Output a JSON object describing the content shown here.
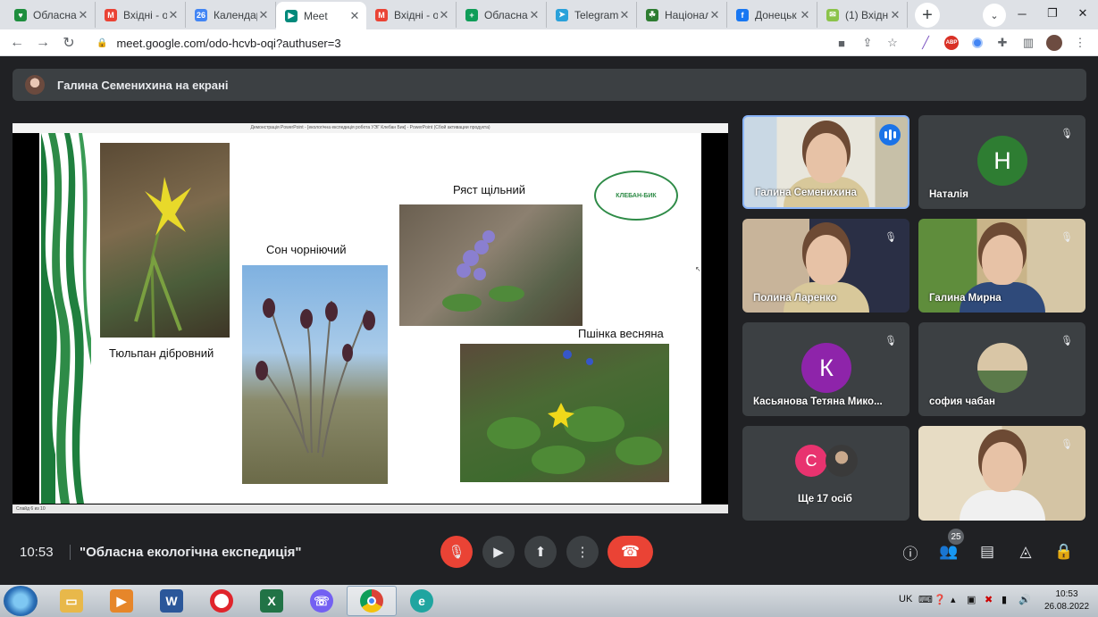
{
  "tabs": [
    {
      "title": "Обласна",
      "fav_color": "#1e8e3e",
      "fav": "♥"
    },
    {
      "title": "Вхідні - о",
      "fav_color": "#ea4335",
      "fav": "M"
    },
    {
      "title": "Календар",
      "fav_color": "#4285f4",
      "fav": "26"
    },
    {
      "title": "Meet",
      "fav_color": "#00897b",
      "fav": "▶"
    },
    {
      "title": "Вхідні - о",
      "fav_color": "#ea4335",
      "fav": "M"
    },
    {
      "title": "Обласна",
      "fav_color": "#0f9d58",
      "fav": "+"
    },
    {
      "title": "Telegram",
      "fav_color": "#2aa1da",
      "fav": "➤"
    },
    {
      "title": "Національ",
      "fav_color": "#2e7d32",
      "fav": "☘"
    },
    {
      "title": "Донецьк",
      "fav_color": "#1877f2",
      "fav": "f"
    },
    {
      "title": "(1) Вхідн",
      "fav_color": "#8bc34a",
      "fav": "✉"
    }
  ],
  "toolbar": {
    "url": "meet.google.com/odo-hcvb-oqi?authuser=3"
  },
  "notice": {
    "presenter_text": "Галина Семенихина на екрані"
  },
  "slide": {
    "title_bar": "Демонстрація PowerPoint - [екологічна експедиція робота УЭГ Клебан Бик] - PowerPoint (Сбой активации продукта)",
    "status": "Слайд 6 из 10",
    "labels": {
      "tulip": "Тюльпан дібровний",
      "pasque": "Сон чорніючий",
      "corydalis": "Ряст щільний",
      "ficaria": "Пшінка весняна"
    },
    "logo_text": "КЛЕБАН-БИК"
  },
  "participants": [
    {
      "name": "Галина Семенихина",
      "type": "video",
      "speaking": true
    },
    {
      "name": "Наталія",
      "type": "letter",
      "letter": "Н",
      "color": "#2e7d32",
      "muted": true
    },
    {
      "name": "Полина Ларенко",
      "type": "video",
      "muted": true
    },
    {
      "name": "Галина Мирна",
      "type": "video",
      "muted": true
    },
    {
      "name": "Касьянова Тетяна Мико...",
      "type": "letter",
      "letter": "К",
      "color": "#8e24aa",
      "muted": true
    },
    {
      "name": "софия чабан",
      "type": "photo",
      "muted": true
    },
    {
      "name": "Ще 17 осіб",
      "type": "more",
      "letter": "С",
      "color": "#e8336f"
    },
    {
      "name": "",
      "type": "video",
      "muted": true
    }
  ],
  "bottom": {
    "time": "10:53",
    "meeting_name": "\"Обласна екологічна експедиція\"",
    "people_count": "25"
  },
  "taskbar": {
    "lang": "UK",
    "time": "10:53",
    "date": "26.08.2022"
  }
}
